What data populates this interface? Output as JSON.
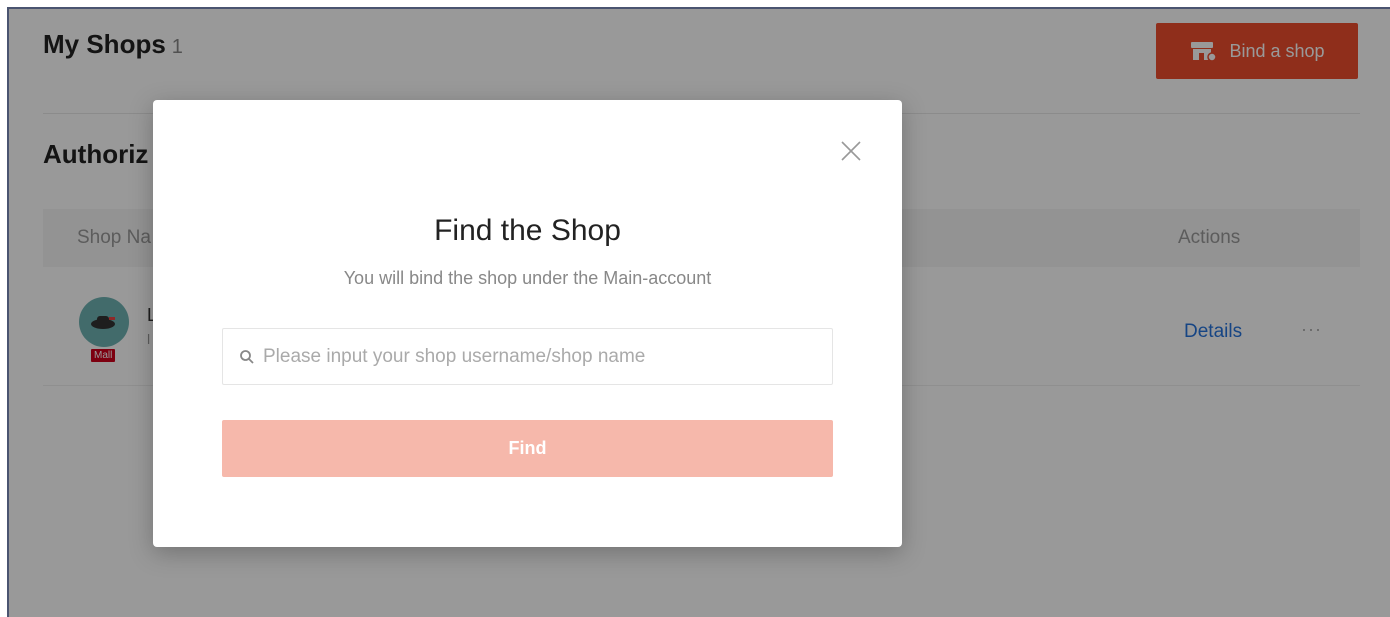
{
  "header": {
    "title": "My Shops",
    "count": "1",
    "bind_button_label": "Bind a shop"
  },
  "section": {
    "title": "Authoriz"
  },
  "table": {
    "columns": [
      "Shop Na",
      "Actions"
    ],
    "rows": [
      {
        "name": "L",
        "subtext": "l",
        "badge": "Mall",
        "details_label": "Details",
        "more_label": "···"
      }
    ]
  },
  "modal": {
    "title": "Find the Shop",
    "subtitle": "You will bind the shop under the Main-account",
    "search_placeholder": "Please input your shop username/shop name",
    "find_label": "Find"
  },
  "colors": {
    "accent": "#ee4d2d",
    "find_disabled": "#f6b8ab",
    "link": "#2673dd"
  }
}
